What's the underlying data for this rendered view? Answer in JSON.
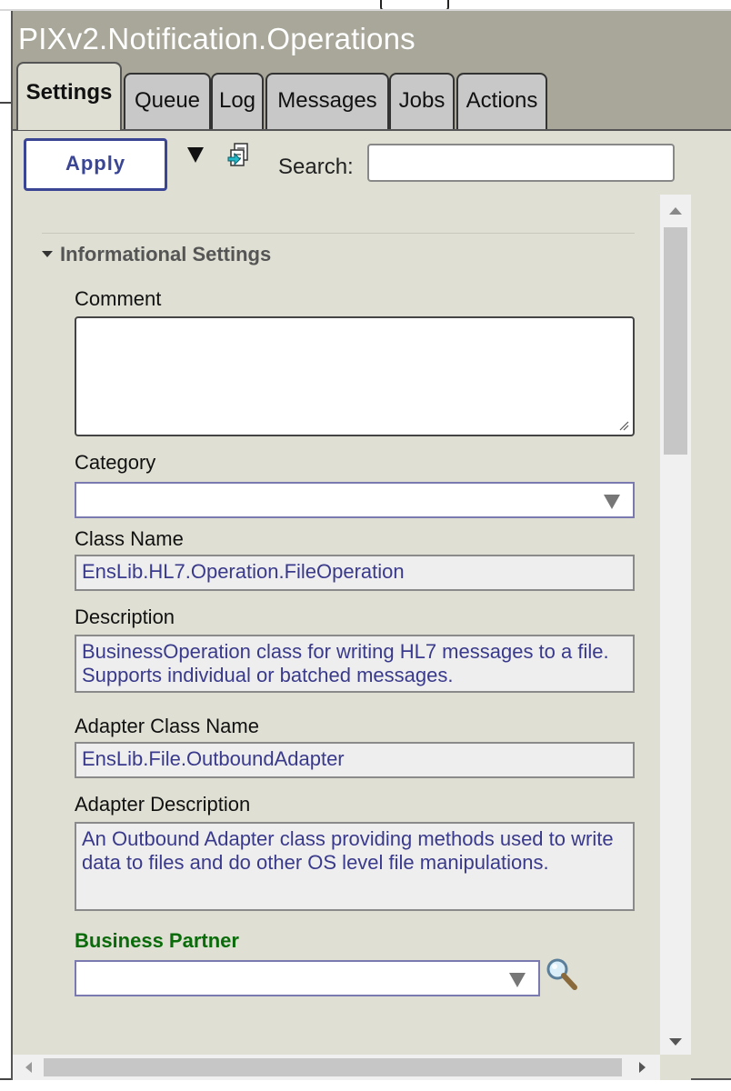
{
  "window": {
    "title": "PIXv2.Notification.Operations"
  },
  "tabs": [
    {
      "label": "Settings",
      "active": true
    },
    {
      "label": "Queue"
    },
    {
      "label": "Log"
    },
    {
      "label": "Messages"
    },
    {
      "label": "Jobs"
    },
    {
      "label": "Actions"
    }
  ],
  "toolbar": {
    "apply_label": "Apply",
    "search_label": "Search:",
    "search_value": "",
    "icons": [
      "dropdown-arrow-icon",
      "export-icon"
    ]
  },
  "section": {
    "title": "Informational Settings",
    "expanded": true
  },
  "fields": {
    "comment": {
      "label": "Comment",
      "value": ""
    },
    "category": {
      "label": "Category",
      "value": ""
    },
    "class_name": {
      "label": "Class Name",
      "value": "EnsLib.HL7.Operation.FileOperation"
    },
    "description": {
      "label": "Description",
      "value": "BusinessOperation class for writing HL7 messages to a file. Supports individual or batched messages."
    },
    "adapter_class_name": {
      "label": "Adapter Class Name",
      "value": "EnsLib.File.OutboundAdapter"
    },
    "adapter_description": {
      "label": "Adapter Description",
      "value": "An Outbound Adapter class providing methods used to write data to files and do other OS level file manipulations."
    },
    "business_partner": {
      "label": "Business Partner",
      "value": ""
    }
  },
  "colors": {
    "panel_bg": "#a8a799",
    "content_bg": "#dfdfd3",
    "accent_blue": "#3a4694",
    "readonly_text": "#3a3a8c",
    "partner_label": "#0a6b0a"
  }
}
